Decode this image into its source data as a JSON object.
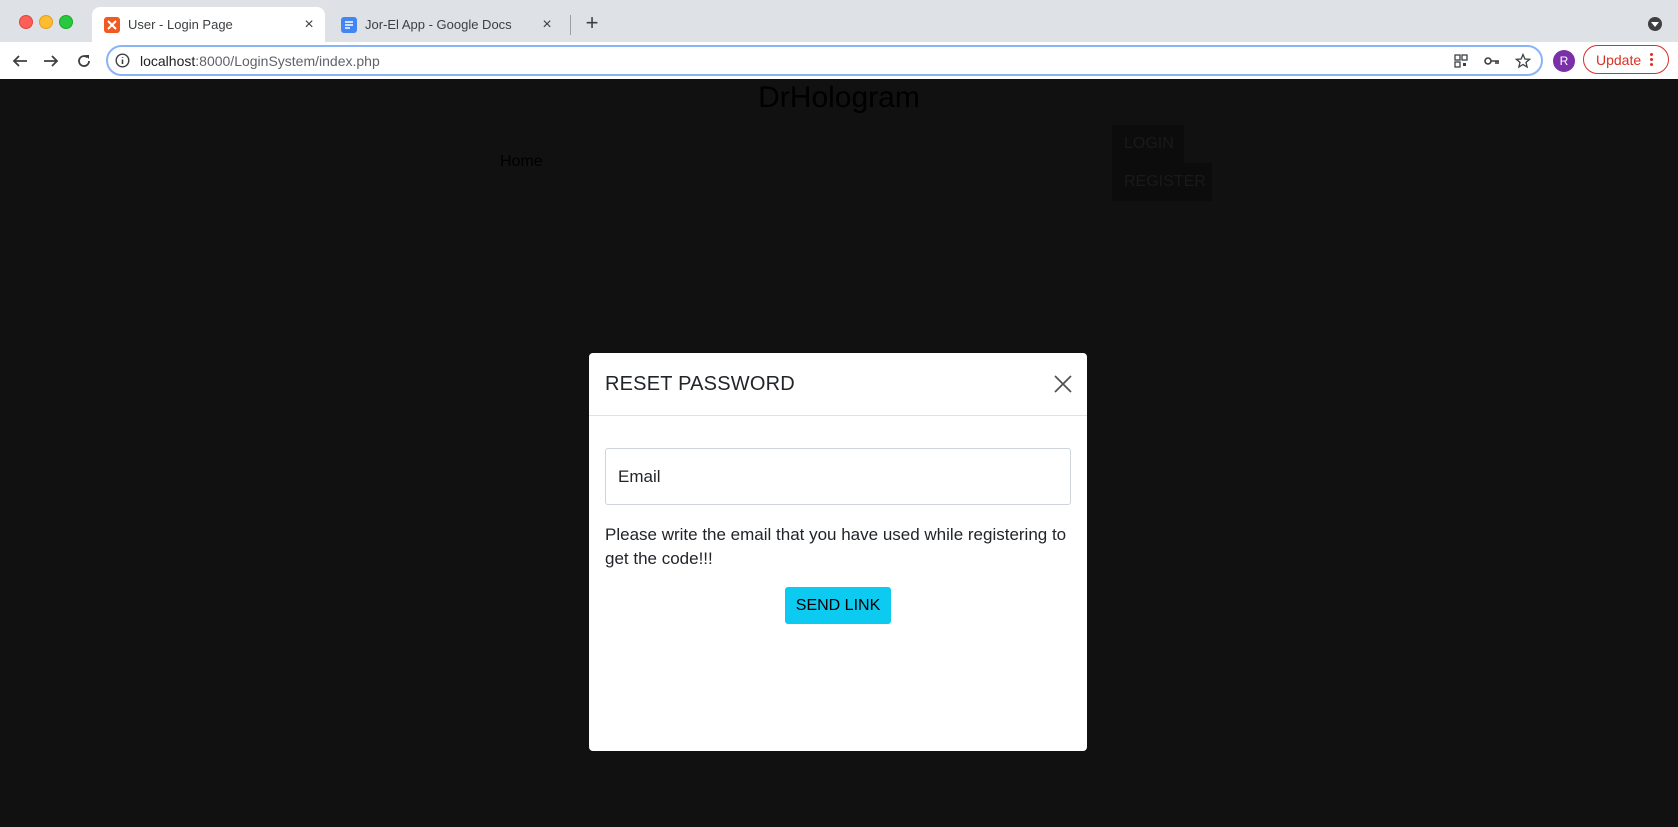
{
  "browser": {
    "tabs": [
      {
        "title": "User - Login Page",
        "active": true
      },
      {
        "title": "Jor-El App - Google Docs",
        "active": false
      }
    ],
    "url": {
      "host": "localhost",
      "rest": ":8000/LoginSystem/index.php"
    },
    "profile_initial": "R",
    "update_label": "Update",
    "icons": [
      "back-arrow-icon",
      "forward-arrow-icon",
      "reload-icon",
      "info-icon",
      "qr-code-icon",
      "key-icon",
      "star-icon",
      "more-vert-icon"
    ]
  },
  "site": {
    "title": "DrHologram",
    "nav": {
      "home": "Home"
    },
    "buttons": {
      "login": "LOGIN",
      "register": "REGISTER"
    }
  },
  "modal": {
    "title": "RESET PASSWORD",
    "email_placeholder": "Email",
    "help_text": "Please write the email that you have used while registering to get the code!!!",
    "submit_label": "SEND LINK"
  },
  "colors": {
    "overlay": "#111111",
    "send_button": "#0dcaf0",
    "update_button": "#d93025",
    "avatar": "#7b2fa8"
  }
}
